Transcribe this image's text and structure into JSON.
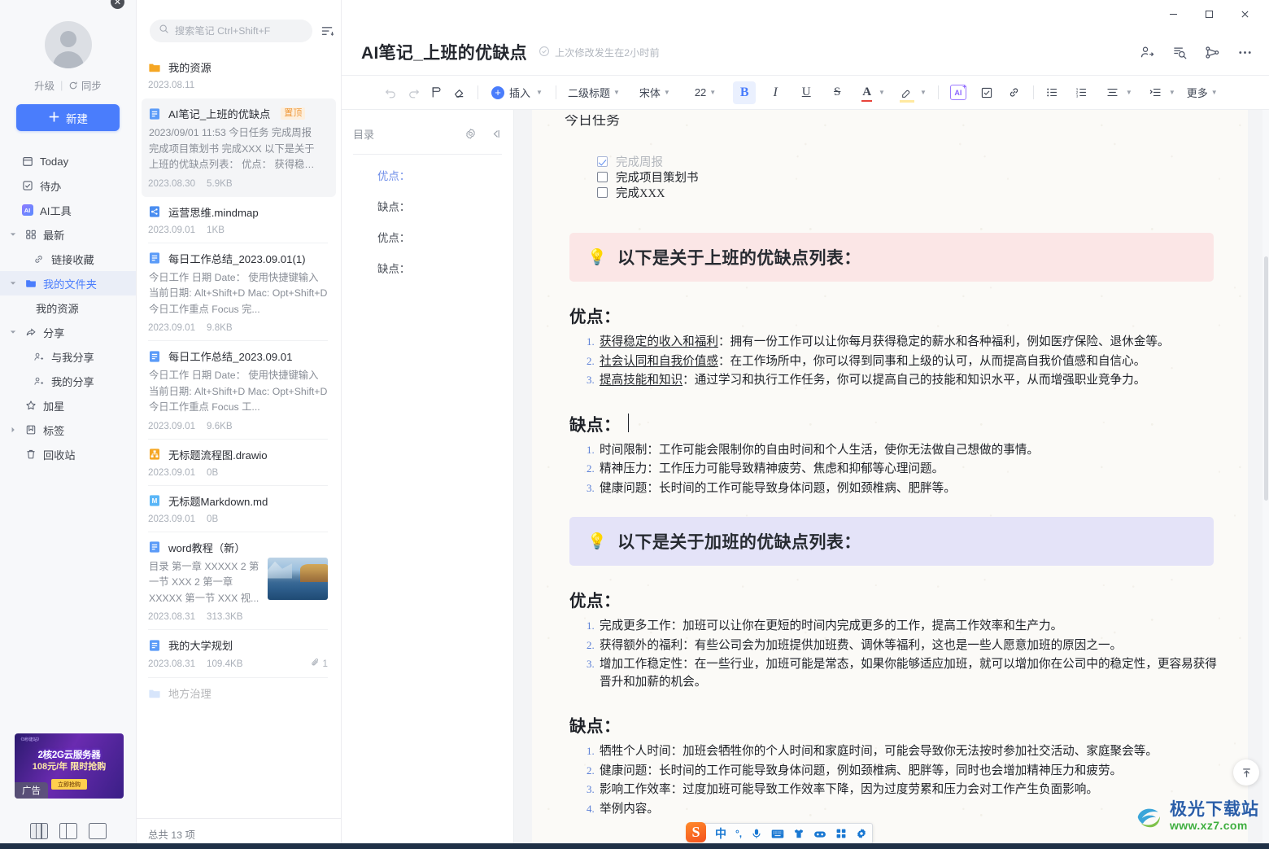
{
  "sidebar": {
    "upgrade_label": "升级",
    "sync_label": "同步",
    "new_button": "新建",
    "items": [
      {
        "label": "Today",
        "icon": "calendar-icon",
        "level": "top"
      },
      {
        "label": "待办",
        "icon": "checkbox-icon",
        "level": "top"
      },
      {
        "label": "AI工具",
        "icon": "ai-icon",
        "level": "top"
      },
      {
        "label": "最新",
        "icon": "grid-icon",
        "level": "group"
      },
      {
        "label": "链接收藏",
        "icon": "link-icon",
        "level": "sub"
      },
      {
        "label": "我的文件夹",
        "icon": "folder-icon",
        "level": "group",
        "active": true
      },
      {
        "label": "我的资源",
        "icon": "none",
        "level": "sub2"
      },
      {
        "label": "分享",
        "icon": "share-icon",
        "level": "group"
      },
      {
        "label": "与我分享",
        "icon": "user-in-icon",
        "level": "sub"
      },
      {
        "label": "我的分享",
        "icon": "user-out-icon",
        "level": "sub"
      },
      {
        "label": "加星",
        "icon": "star-icon",
        "level": "group-nocaret"
      },
      {
        "label": "标签",
        "icon": "tag-icon",
        "level": "group-collapsed"
      },
      {
        "label": "回收站",
        "icon": "trash-icon",
        "level": "group-nocaret"
      }
    ],
    "ad": {
      "line0": "《9秒建站》",
      "line1": "2核2G云服务器",
      "line2": "108元/年 限时抢购",
      "button": "立即抢购",
      "tag": "广告",
      "close": "✕"
    },
    "layout_buttons": [
      "三栏布局",
      "两栏布局",
      "单栏布局"
    ]
  },
  "list": {
    "search_placeholder": "搜索笔记 Ctrl+Shift+F",
    "sort_icon": "sort-icon",
    "footer": "总共 13 项",
    "items": [
      {
        "title": "我的资源",
        "icon": "folder-icon",
        "snippet": "",
        "date": "2023.08.11",
        "size": "",
        "selected": false,
        "pinned": false,
        "thumb": false
      },
      {
        "title": "AI笔记_上班的优缺点",
        "icon": "doc-icon",
        "pin_label": "置顶",
        "snippet": "2023/09/01 11:53 今日任务 完成周报 完成项目策划书 完成XXX 以下是关于上班的优缺点列表： 优点： 获得稳定的收入...",
        "date": "2023.08.30",
        "size": "5.9KB",
        "selected": true,
        "pinned": true,
        "thumb": false
      },
      {
        "title": "运营思维.mindmap",
        "icon": "mindmap-icon",
        "snippet": "",
        "date": "2023.09.01",
        "size": "1KB",
        "selected": false,
        "pinned": false,
        "thumb": false
      },
      {
        "title": "每日工作总结_2023.09.01(1)",
        "icon": "doc-icon",
        "snippet": "今日工作 日期 Date： 使用快捷键输入当前日期: Alt+Shift+D Mac: Opt+Shift+D 今日工作重点 Focus 完...",
        "date": "2023.09.01",
        "size": "9.8KB",
        "selected": false,
        "pinned": false,
        "thumb": false
      },
      {
        "title": "每日工作总结_2023.09.01",
        "icon": "doc-icon",
        "snippet": "今日工作 日期 Date： 使用快捷键输入当前日期: Alt+Shift+D Mac: Opt+Shift+D 今日工作重点 Focus 工...",
        "date": "2023.09.01",
        "size": "9.6KB",
        "selected": false,
        "pinned": false,
        "thumb": false
      },
      {
        "title": "无标题流程图.drawio",
        "icon": "drawio-icon",
        "snippet": "",
        "date": "2023.09.01",
        "size": "0B",
        "selected": false,
        "pinned": false,
        "thumb": false
      },
      {
        "title": "无标题Markdown.md",
        "icon": "markdown-icon",
        "snippet": "",
        "date": "2023.09.01",
        "size": "0B",
        "selected": false,
        "pinned": false,
        "thumb": false
      },
      {
        "title": "word教程（新）",
        "icon": "doc-icon",
        "snippet": "目录 第一章 XXXXX 2 第一节 XXX 2 第一章 XXXXX 第一节 XXX 视...",
        "date": "2023.08.31",
        "size": "313.3KB",
        "selected": false,
        "pinned": false,
        "thumb": true
      },
      {
        "title": "我的大学规划",
        "icon": "doc-icon",
        "snippet": "",
        "date": "2023.08.31",
        "size": "109.4KB",
        "attachments": "1",
        "selected": false,
        "pinned": false,
        "thumb": false
      }
    ]
  },
  "window": {
    "minimize": "—",
    "maximize": "□",
    "close": "✕"
  },
  "header": {
    "doc_title": "AI笔记_上班的优缺点",
    "saved_status": "上次修改发生在2小时前",
    "actions": [
      "share-user-icon",
      "doc-search-icon",
      "mindmap-node-icon",
      "more-icon"
    ]
  },
  "toolbar": {
    "undo": "undo-icon",
    "redo": "redo-icon",
    "format_brush": "format-brush-icon",
    "clear_format": "clear-format-icon",
    "insert_label": "插入",
    "heading_label": "二级标题",
    "font_label": "宋体",
    "size_label": "22",
    "bold": "B",
    "italic": "I",
    "underline": "U",
    "strike": "S",
    "font_color": "A",
    "highlight": "highlight-icon",
    "ai_label": "AI",
    "checkbox_tool": "checkbox-icon",
    "link_tool": "link-icon",
    "bullet_list": "bullet-list-icon",
    "number_list": "numbered-list-icon",
    "align": "align-icon",
    "indent": "indent-icon",
    "more_label": "更多"
  },
  "toc": {
    "title": "目录",
    "settings_icon": "gear-icon",
    "collapse_icon": "collapse-left-icon",
    "items": [
      {
        "label": "优点：",
        "active": true
      },
      {
        "label": "缺点：",
        "active": false
      },
      {
        "label": "优点：",
        "active": false
      },
      {
        "label": "缺点：",
        "active": false
      }
    ]
  },
  "document": {
    "clipped_heading": "今日任务",
    "todos": [
      {
        "text": "完成周报",
        "done": true
      },
      {
        "text": "完成项目策划书",
        "done": false
      },
      {
        "text": "完成XXX",
        "done": false
      }
    ],
    "sections": [
      {
        "callout": "以下是关于上班的优缺点列表：",
        "callout_color": "pink",
        "blocks": [
          {
            "heading": "优点：",
            "cursor": false,
            "items": [
              {
                "term": "获得稳定的收入和福利",
                "desc": "：拥有一份工作可以让你每月获得稳定的薪水和各种福利，例如医疗保险、退休金等。"
              },
              {
                "term": "社会认同和自我价值感",
                "desc": "：在工作场所中，你可以得到同事和上级的认可，从而提高自我价值感和自信心。"
              },
              {
                "term": "提高技能和知识",
                "desc": "：通过学习和执行工作任务，你可以提高自己的技能和知识水平，从而增强职业竞争力。"
              }
            ]
          },
          {
            "heading": "缺点：",
            "cursor": true,
            "items": [
              {
                "term": "",
                "desc": "时间限制：工作可能会限制你的自由时间和个人生活，使你无法做自己想做的事情。"
              },
              {
                "term": "",
                "desc": "精神压力：工作压力可能导致精神疲劳、焦虑和抑郁等心理问题。"
              },
              {
                "term": "",
                "desc": "健康问题：长时间的工作可能导致身体问题，例如颈椎病、肥胖等。"
              }
            ]
          }
        ]
      },
      {
        "callout": "以下是关于加班的优缺点列表：",
        "callout_color": "purple",
        "blocks": [
          {
            "heading": "优点：",
            "cursor": false,
            "items": [
              {
                "term": "",
                "desc": "完成更多工作：加班可以让你在更短的时间内完成更多的工作，提高工作效率和生产力。"
              },
              {
                "term": "",
                "desc": "获得额外的福利：有些公司会为加班提供加班费、调休等福利，这也是一些人愿意加班的原因之一。"
              },
              {
                "term": "",
                "desc": "增加工作稳定性：在一些行业，加班可能是常态，如果你能够适应加班，就可以增加你在公司中的稳定性，更容易获得晋升和加薪的机会。"
              }
            ]
          },
          {
            "heading": "缺点：",
            "cursor": false,
            "items": [
              {
                "term": "",
                "desc": "牺牲个人时间：加班会牺牲你的个人时间和家庭时间，可能会导致你无法按时参加社交活动、家庭聚会等。"
              },
              {
                "term": "",
                "desc": "健康问题：长时间的工作可能导致身体问题，例如颈椎病、肥胖等，同时也会增加精神压力和疲劳。"
              },
              {
                "term": "",
                "desc": "影响工作效率：过度加班可能导致工作效率下降，因为过度劳累和压力会对工作产生负面影响。"
              },
              {
                "term": "",
                "desc": "举例内容。"
              }
            ]
          }
        ]
      }
    ],
    "scroll_top_icon": "scroll-to-top-icon"
  },
  "ime": {
    "logo": "S",
    "mode": "中",
    "punct": "°,",
    "mic": "mic-icon",
    "keyboard": "keyboard-icon",
    "skin": "skin-icon",
    "toolbox": "toolbox-icon",
    "apps": "apps-icon",
    "settings": "settings-icon"
  },
  "watermark": {
    "cn": "极光下载站",
    "en": "www.xz7.com"
  },
  "colors": {
    "accent": "#4a7dfc",
    "callout_pink": "#fbe6e6",
    "callout_purple": "#e4e3f8",
    "pin_badge_bg": "#fdefdd",
    "pin_badge_text": "#ef9a3d",
    "paper": "#fbfaf7"
  }
}
